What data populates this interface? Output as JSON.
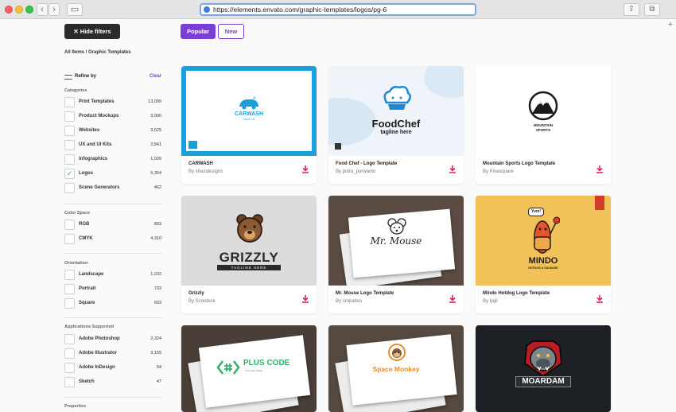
{
  "browser": {
    "url": "https://elements.envato.com/graphic-templates/logos/pg-6",
    "back_glyph": "‹",
    "forward_glyph": "›",
    "sidebar_glyph": "▭",
    "share_glyph": "⇧",
    "tabs_glyph": "⧉",
    "new_tab_glyph": "+"
  },
  "filters": {
    "hide_label": "✕ Hide filters",
    "breadcrumb": "All Items / Graphic Templates",
    "refine_label": "Refine by",
    "clear_label": "Clear",
    "sections": [
      {
        "title": "Categories",
        "items": [
          {
            "name": "Print Templates",
            "count": "13,099",
            "checked": false
          },
          {
            "name": "Product Mockups",
            "count": "3,900",
            "checked": false
          },
          {
            "name": "Websites",
            "count": "3,625",
            "checked": false
          },
          {
            "name": "UX and UI Kits",
            "count": "2,841",
            "checked": false
          },
          {
            "name": "Infographics",
            "count": "1,026",
            "checked": false
          },
          {
            "name": "Logos",
            "count": "5,354",
            "checked": true
          },
          {
            "name": "Scene Generators",
            "count": "462",
            "checked": false
          }
        ]
      },
      {
        "title": "Color Space",
        "items": [
          {
            "name": "RGB",
            "count": "893",
            "checked": false
          },
          {
            "name": "CMYK",
            "count": "4,310",
            "checked": false
          }
        ]
      },
      {
        "title": "Orientation",
        "items": [
          {
            "name": "Landscape",
            "count": "1,232",
            "checked": false
          },
          {
            "name": "Portrait",
            "count": "733",
            "checked": false
          },
          {
            "name": "Square",
            "count": "603",
            "checked": false
          }
        ]
      },
      {
        "title": "Applications Supported",
        "items": [
          {
            "name": "Adobe Photoshop",
            "count": "2,324",
            "checked": false
          },
          {
            "name": "Adobe Illustrator",
            "count": "3,155",
            "checked": false
          },
          {
            "name": "Adobe InDesign",
            "count": "54",
            "checked": false
          },
          {
            "name": "Sketch",
            "count": "47",
            "checked": false
          }
        ]
      },
      {
        "title": "Properties",
        "items": []
      }
    ]
  },
  "sort": {
    "popular": "Popular",
    "new": "New"
  },
  "cards": [
    {
      "title": "CARWASH",
      "author": "By shazidesigns",
      "logo": "CARWASH",
      "logo_sub": "CLEAN UP"
    },
    {
      "title": "Food Chef - Logo Template",
      "author": "By putra_purwanto",
      "logo": "FoodChef",
      "logo_sub": "tagline here"
    },
    {
      "title": "Mountain Sports Logo Template",
      "author": "By Pixasquare",
      "logo": "MOUNTAIN",
      "logo_sub": "SPORTS"
    },
    {
      "title": "Grizzly",
      "author": "By Scredeck",
      "logo": "GRIZZLY",
      "logo_sub": "TAGLINE HERE"
    },
    {
      "title": "Mr. Mouse Logo Template",
      "author": "By ompativo",
      "logo": "Mr. Mouse",
      "logo_sub": ""
    },
    {
      "title": "Mindo Hotdog Logo Template",
      "author": "By ljajil",
      "logo": "MINDO",
      "logo_sub": "HOTDOG & SAUSAGE",
      "badge": "Yum!"
    },
    {
      "title": "",
      "author": "",
      "logo": "PLUS CODE",
      "logo_sub": "TAGLINE HERE"
    },
    {
      "title": "",
      "author": "",
      "logo": "Space Monkey",
      "logo_sub": ""
    },
    {
      "title": "",
      "author": "",
      "logo": "MOARDAM",
      "logo_sub": ""
    }
  ],
  "colors": {
    "accent": "#7b3fd8",
    "download": "#e0245e",
    "dark": "#2b2b2b"
  }
}
